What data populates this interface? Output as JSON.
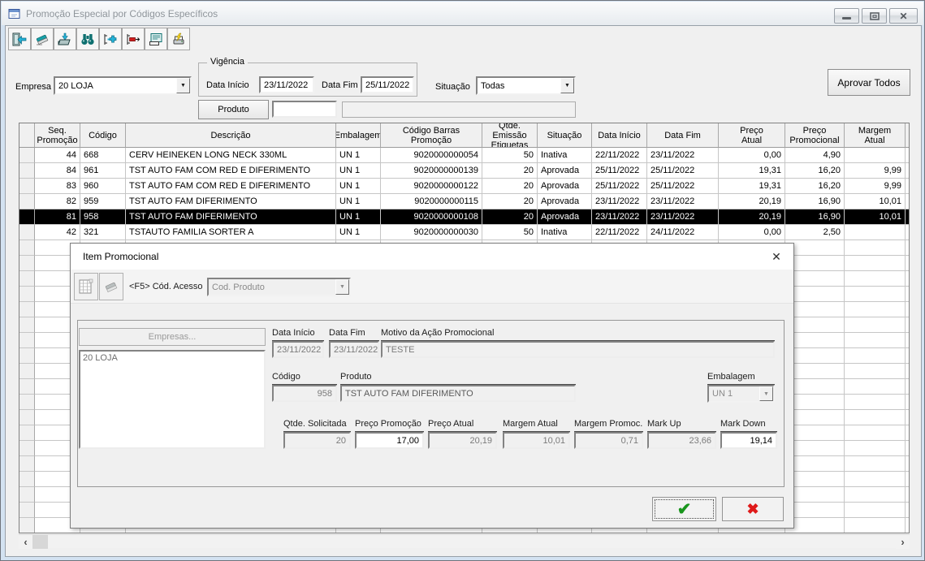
{
  "window": {
    "title": "Promoção Especial por Códigos Específicos"
  },
  "icons": {
    "close_window": "✕",
    "dialog_close": "✕",
    "combo_arrow": "▼",
    "scroll_left": "‹",
    "scroll_right": "›",
    "ok_check": "✔",
    "cancel_cross": "✖"
  },
  "colors": {
    "selected_row_bg": "#000000",
    "selected_row_text": "#ffffff",
    "toolbar_teal": "#0e7070",
    "toolbar_cyan": "#25b3d9",
    "delete_red": "#cf1d1d",
    "print_yellow": "#f4d023",
    "ok_green": "#18951c",
    "cancel_red": "#df1a1a"
  },
  "toolbar": {
    "buttons": [
      "exit",
      "erase",
      "save",
      "find",
      "insert",
      "delete",
      "preview",
      "print"
    ]
  },
  "filters": {
    "empresa_label": "Empresa",
    "empresa_value": "20 LOJA",
    "vigencia_legend": "Vigência",
    "data_inicio_label": "Data Início",
    "data_inicio_value": "23/11/2022",
    "data_fim_label": "Data Fim",
    "data_fim_value": "25/11/2022",
    "situacao_label": "Situação",
    "situacao_value": "Todas",
    "produto_button": "Produto",
    "produto_code": "",
    "produto_desc": "",
    "aprovar_todos": "Aprovar Todos"
  },
  "grid": {
    "columns": [
      {
        "key": "seq",
        "label": "Seq.\nPromoção"
      },
      {
        "key": "cod",
        "label": "Código"
      },
      {
        "key": "desc",
        "label": "Descrição"
      },
      {
        "key": "emb",
        "label": "Embalagem"
      },
      {
        "key": "barras",
        "label": "Código Barras\nPromoção"
      },
      {
        "key": "qtde",
        "label": "Qtde. Emissão\nEtiquetas"
      },
      {
        "key": "sit",
        "label": "Situação"
      },
      {
        "key": "di",
        "label": "Data Início"
      },
      {
        "key": "df",
        "label": "Data Fim"
      },
      {
        "key": "pa",
        "label": "Preço\nAtual"
      },
      {
        "key": "pp",
        "label": "Preço\nPromocional"
      },
      {
        "key": "ma",
        "label": "Margem\nAtual"
      }
    ],
    "selected_index": 4,
    "rows": [
      {
        "seq": "44",
        "cod": "668",
        "desc": "CERV HEINEKEN LONG NECK 330ML",
        "emb": "UN 1",
        "barras": "9020000000054",
        "qtde": "50",
        "sit": "Inativa",
        "di": "22/11/2022",
        "df": "23/11/2022",
        "pa": "0,00",
        "pp": "4,90",
        "ma": ""
      },
      {
        "seq": "84",
        "cod": "961",
        "desc": "TST AUTO FAM COM RED E DIFERIMENTO",
        "emb": "UN 1",
        "barras": "9020000000139",
        "qtde": "20",
        "sit": "Aprovada",
        "di": "25/11/2022",
        "df": "25/11/2022",
        "pa": "19,31",
        "pp": "16,20",
        "ma": "9,99"
      },
      {
        "seq": "83",
        "cod": "960",
        "desc": "TST AUTO FAM COM RED E DIFERIMENTO",
        "emb": "UN 1",
        "barras": "9020000000122",
        "qtde": "20",
        "sit": "Aprovada",
        "di": "25/11/2022",
        "df": "25/11/2022",
        "pa": "19,31",
        "pp": "16,20",
        "ma": "9,99"
      },
      {
        "seq": "82",
        "cod": "959",
        "desc": "TST AUTO FAM DIFERIMENTO",
        "emb": "UN 1",
        "barras": "9020000000115",
        "qtde": "20",
        "sit": "Aprovada",
        "di": "23/11/2022",
        "df": "23/11/2022",
        "pa": "20,19",
        "pp": "16,90",
        "ma": "10,01"
      },
      {
        "seq": "81",
        "cod": "958",
        "desc": "TST AUTO FAM DIFERIMENTO",
        "emb": "UN 1",
        "barras": "9020000000108",
        "qtde": "20",
        "sit": "Aprovada",
        "di": "23/11/2022",
        "df": "23/11/2022",
        "pa": "20,19",
        "pp": "16,90",
        "ma": "10,01"
      },
      {
        "seq": "42",
        "cod": "321",
        "desc": "TSTAUTO FAMILIA SORTER A",
        "emb": "UN 1",
        "barras": "9020000000030",
        "qtde": "50",
        "sit": "Inativa",
        "di": "22/11/2022",
        "df": "24/11/2022",
        "pa": "0,00",
        "pp": "2,50",
        "ma": ""
      }
    ]
  },
  "dialog": {
    "title": "Item Promocional",
    "toolbar": {
      "acesso_label": "<F5> Cód. Acesso",
      "acesso_combo_value": "Cod. Produto"
    },
    "empresas_button": "Empresas...",
    "empresas_list": [
      "20 LOJA"
    ],
    "fields": {
      "data_inicio": {
        "label": "Data Início",
        "value": "23/11/2022"
      },
      "data_fim": {
        "label": "Data Fim",
        "value": "23/11/2022"
      },
      "motivo": {
        "label": "Motivo da Ação Promocional",
        "value": "TESTE"
      },
      "codigo": {
        "label": "Código",
        "value": "958"
      },
      "produto": {
        "label": "Produto",
        "value": "TST AUTO FAM DIFERIMENTO"
      },
      "embalagem": {
        "label": "Embalagem",
        "value": "UN 1"
      },
      "qtde_solicitada": {
        "label": "Qtde. Solicitada",
        "value": "20"
      },
      "preco_promocao": {
        "label": "Preço Promoção",
        "value": "17,00"
      },
      "preco_atual": {
        "label": "Preço Atual",
        "value": "20,19"
      },
      "margem_atual": {
        "label": "Margem Atual",
        "value": "10,01"
      },
      "margem_promoc": {
        "label": "Margem Promoc.",
        "value": "0,71"
      },
      "mark_up": {
        "label": "Mark Up",
        "value": "23,66"
      },
      "mark_down": {
        "label": "Mark Down",
        "value": "19,14"
      }
    }
  }
}
